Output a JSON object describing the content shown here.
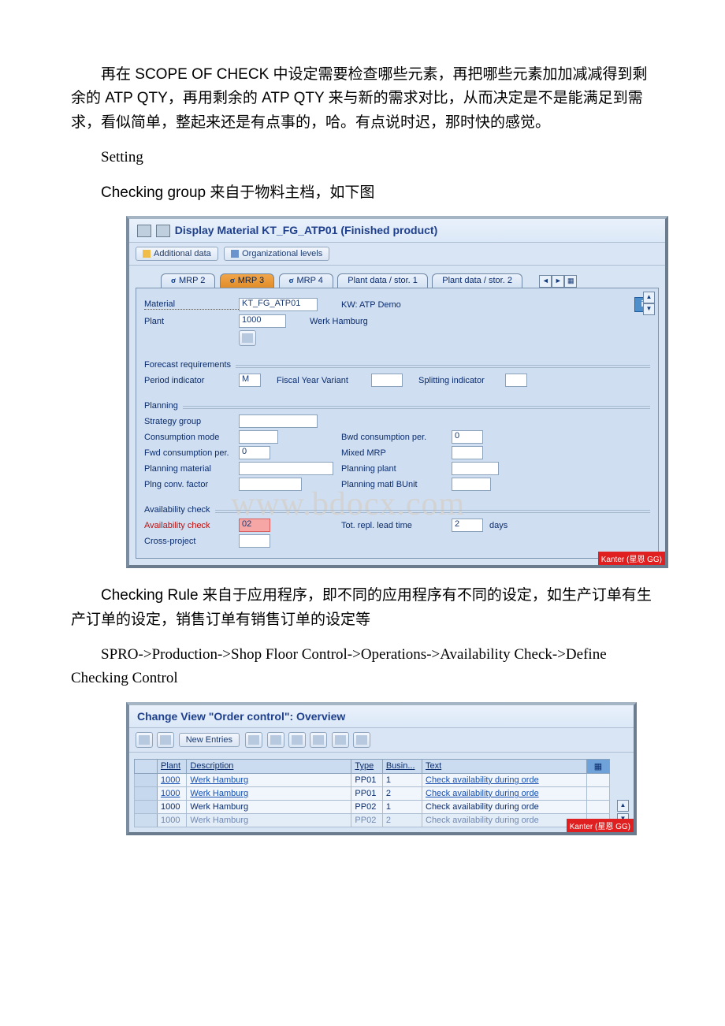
{
  "paragraphs": {
    "p1": "再在 SCOPE OF CHECK 中设定需要检查哪些元素，再把哪些元素加加减减得到剩余的 ATP QTY，再用剩余的 ATP QTY 来与新的需求对比，从而决定是不是能满足到需求，看似简单，整起来还是有点事的，哈。有点说时迟，那时快的感觉。",
    "p2": "Setting",
    "p3": "Checking group 来自于物料主档，如下图",
    "p4": "Checking Rule 来自于应用程序，即不同的应用程序有不同的设定，如生产订单有生产订单的设定，销售订单有销售订单的设定等",
    "p5": "SPRO->Production->Shop Floor Control->Operations->Availability Check->Define Checking Control"
  },
  "sap1": {
    "title": "Display Material KT_FG_ATP01 (Finished product)",
    "toolbar": {
      "additional": "Additional data",
      "org": "Organizational levels"
    },
    "tabs": {
      "mrp2": "MRP 2",
      "mrp3": "MRP 3",
      "mrp4": "MRP 4",
      "pd1": "Plant data / stor. 1",
      "pd2": "Plant data / stor. 2"
    },
    "header": {
      "material_label": "Material",
      "material_value": "KT_FG_ATP01",
      "material_desc": "KW: ATP Demo",
      "plant_label": "Plant",
      "plant_value": "1000",
      "plant_desc": "Werk Hamburg"
    },
    "forecast": {
      "title": "Forecast requirements",
      "period_label": "Period indicator",
      "period_value": "M",
      "fyv_label": "Fiscal Year Variant",
      "split_label": "Splitting indicator"
    },
    "planning": {
      "title": "Planning",
      "strategy_label": "Strategy group",
      "cmode_label": "Consumption mode",
      "bwd_label": "Bwd consumption per.",
      "bwd_value": "0",
      "fwd_label": "Fwd consumption per.",
      "fwd_value": "0",
      "mixed_label": "Mixed MRP",
      "pmat_label": "Planning material",
      "pplant_label": "Planning plant",
      "pconv_label": "Plng conv. factor",
      "pbunit_label": "Planning matl BUnit"
    },
    "avail": {
      "title": "Availability check",
      "ac_label": "Availability check",
      "ac_value": "02",
      "trl_label": "Tot. repl. lead time",
      "trl_value": "2",
      "trl_unit": "days",
      "cross_label": "Cross-project"
    },
    "kanter": "Kanter (星恩 GG)",
    "watermark": "www.bdocx.com"
  },
  "sap2": {
    "title": "Change View \"Order control\": Overview",
    "new_entries": "New Entries",
    "columns": {
      "plant": "Plant",
      "desc": "Description",
      "type": "Type",
      "busin": "Busin...",
      "text": "Text"
    },
    "rows": [
      {
        "plant": "1000",
        "desc": "Werk Hamburg",
        "type": "PP01",
        "busin": "1",
        "text": "Check availability during orde",
        "link": true
      },
      {
        "plant": "1000",
        "desc": "Werk Hamburg",
        "type": "PP01",
        "busin": "2",
        "text": "Check availability during orde",
        "link": true
      },
      {
        "plant": "1000",
        "desc": "Werk Hamburg",
        "type": "PP02",
        "busin": "1",
        "text": "Check availability during orde",
        "link": false
      },
      {
        "plant": "1000",
        "desc": "Werk Hamburg",
        "type": "PP02",
        "busin": "2",
        "text": "Check availability during orde",
        "link": false
      }
    ],
    "kanter": "Kanter (星恩 GG)"
  }
}
